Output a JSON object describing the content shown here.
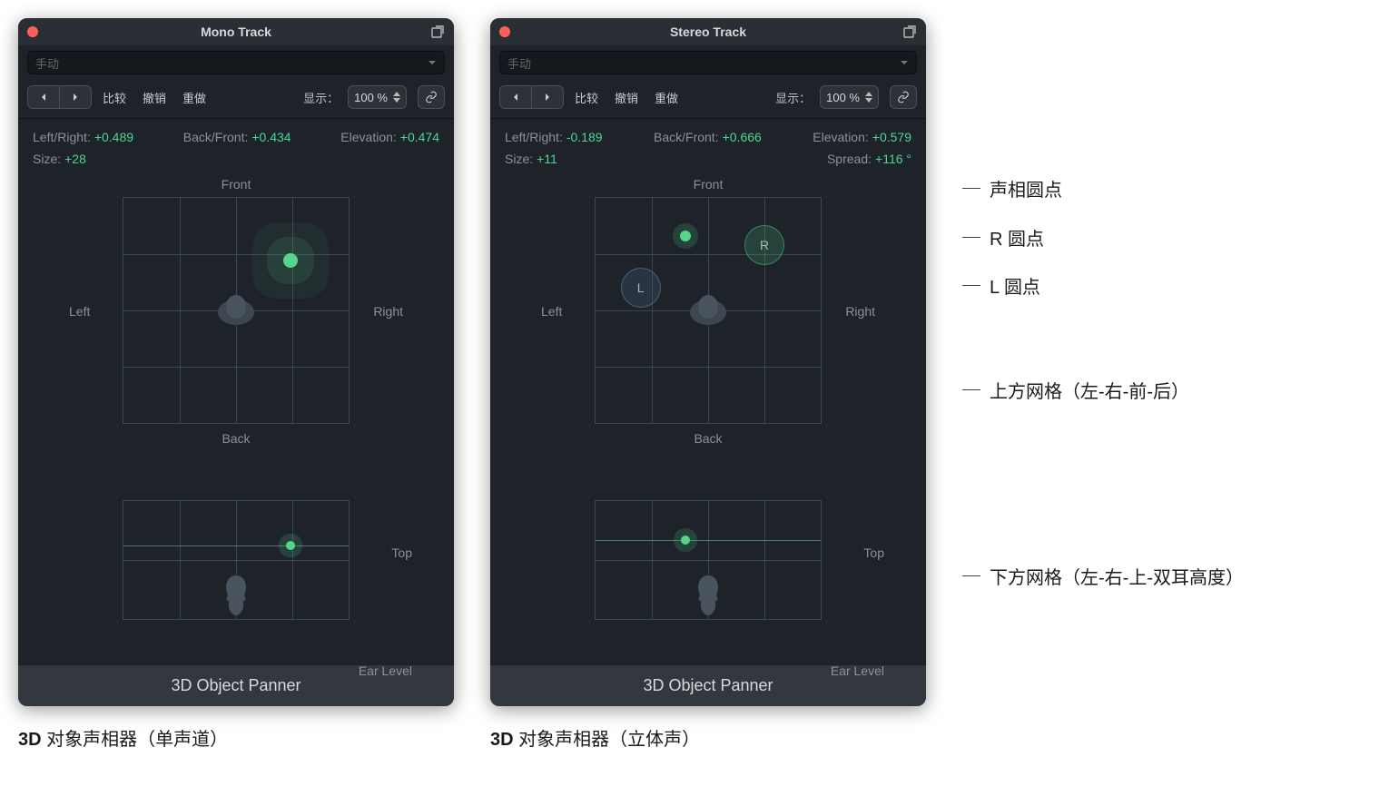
{
  "mono": {
    "title": "Mono Track",
    "preset": "手动",
    "toolbar": {
      "compare": "比较",
      "undo": "撤销",
      "redo": "重做",
      "show": "显示：",
      "zoom": "100 %"
    },
    "readouts": {
      "lr_label": "Left/Right:",
      "lr_val": "+0.489",
      "bf_label": "Back/Front:",
      "bf_val": "+0.434",
      "el_label": "Elevation:",
      "el_val": "+0.474",
      "size_label": "Size:",
      "size_val": "+28"
    },
    "labels": {
      "front": "Front",
      "back": "Back",
      "left": "Left",
      "right": "Right",
      "top": "Top",
      "ear": "Ear Level"
    },
    "footer": "3D Object Panner",
    "caption_bold": "3D",
    "caption_rest": " 对象声相器（单声道）"
  },
  "stereo": {
    "title": "Stereo Track",
    "preset": "手动",
    "toolbar": {
      "compare": "比较",
      "undo": "撤销",
      "redo": "重做",
      "show": "显示：",
      "zoom": "100 %"
    },
    "readouts": {
      "lr_label": "Left/Right:",
      "lr_val": "-0.189",
      "bf_label": "Back/Front:",
      "bf_val": "+0.666",
      "el_label": "Elevation:",
      "el_val": "+0.579",
      "size_label": "Size:",
      "size_val": "+11",
      "sp_label": "Spread:",
      "sp_val": "+116 °"
    },
    "labels": {
      "front": "Front",
      "back": "Back",
      "left": "Left",
      "right": "Right",
      "top": "Top",
      "ear": "Ear Level"
    },
    "footer": "3D Object Panner",
    "lr_puck": {
      "L": "L",
      "R": "R"
    },
    "caption_bold": "3D",
    "caption_rest": " 对象声相器（立体声）"
  },
  "annotations": {
    "pan_puck": "声相圆点",
    "r_puck": "R 圆点",
    "l_puck": "L 圆点",
    "top_grid": "上方网格（左-右-前-后）",
    "bot_grid": "下方网格（左-右-上-双耳高度）"
  }
}
